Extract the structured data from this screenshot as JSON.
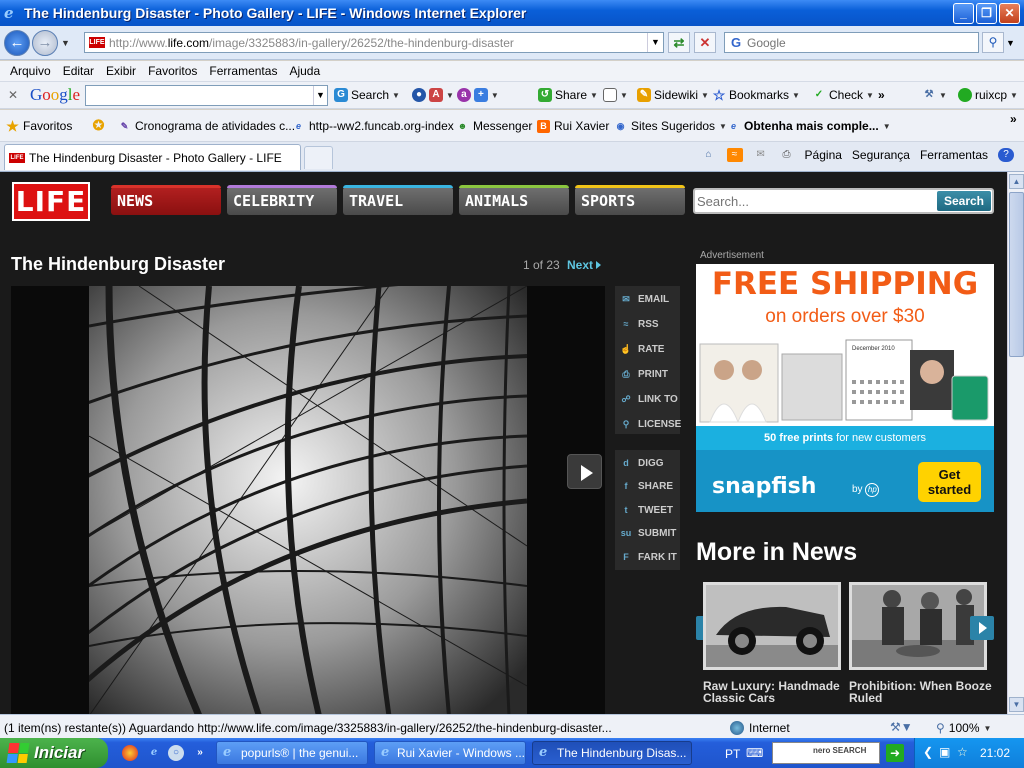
{
  "window": {
    "title": "The Hindenburg Disaster - Photo Gallery - LIFE - Windows Internet Explorer",
    "minimize": "_",
    "maximize": "❐",
    "close": "✕"
  },
  "address_bar": {
    "url_prefix": "http://www.",
    "url_domain": "life.com",
    "url_path": "/image/3325883/in-gallery/26252/the-hindenburg-disaster",
    "favicon": "LIFE",
    "search_placeholder": "Google"
  },
  "menu": [
    "Arquivo",
    "Editar",
    "Exibir",
    "Favoritos",
    "Ferramentas",
    "Ajuda"
  ],
  "google_toolbar": {
    "logo": [
      "G",
      "o",
      "o",
      "g",
      "l",
      "e"
    ],
    "search_label": "Search",
    "share_label": "Share",
    "sidewiki_label": "Sidewiki",
    "bookmarks_label": "Bookmarks",
    "check_label": "Check",
    "more": "»",
    "user": "ruixcp"
  },
  "favorites_bar": {
    "favorites_label": "Favoritos",
    "items": [
      "Cronograma de atividades c...",
      "http--ww2.funcab.org-index",
      "Messenger",
      "Rui Xavier",
      "Sites Sugeridos",
      "Obtenha mais comple..."
    ]
  },
  "tabs": {
    "active_tab": "The Hindenburg Disaster - Photo Gallery - LIFE"
  },
  "command_bar": {
    "pagina": "Página",
    "seguranca": "Segurança",
    "ferramentas": "Ferramentas"
  },
  "site": {
    "logo": "LIFE",
    "nav": [
      {
        "label": "NEWS",
        "color": "#d9322a"
      },
      {
        "label": "CELEBRITY",
        "color": "#b27ad8"
      },
      {
        "label": "TRAVEL",
        "color": "#3ab4e0"
      },
      {
        "label": "ANIMALS",
        "color": "#8cc63f"
      },
      {
        "label": "SPORTS",
        "color": "#f2c418"
      }
    ],
    "search_placeholder": "Search...",
    "search_button": "Search"
  },
  "gallery": {
    "title": "The Hindenburg Disaster",
    "pager": "1 of 23",
    "next": "Next"
  },
  "share_tools": {
    "primary": [
      "EMAIL",
      "RSS",
      "RATE",
      "PRINT",
      "LINK TO",
      "LICENSE"
    ],
    "social": [
      "DIGG",
      "SHARE",
      "TWEET",
      "SUBMIT",
      "FARK IT"
    ]
  },
  "advertisement": {
    "label": "Advertisement",
    "headline": "FREE SHIPPING",
    "subhead": "on orders over $30",
    "calendar_label": "December 2010",
    "prints_bold": "50 free prints",
    "prints_rest": " for new customers",
    "brand": "snapfish",
    "by": "by",
    "hp": "hp",
    "cta": "Get started"
  },
  "more_in_news": {
    "title": "More in News",
    "items": [
      "Raw Luxury: Handmade Classic Cars",
      "Prohibition: When Booze Ruled"
    ]
  },
  "status_bar": {
    "message": "(1 item(ns) restante(s)) Aguardando http://www.life.com/image/3325883/in-gallery/26252/the-hindenburg-disaster...",
    "zone": "Internet",
    "zoom": "100%"
  },
  "taskbar": {
    "start": "Iniciar",
    "items": [
      "popurls® | the genui...",
      "Rui Xavier - Windows ...",
      "The Hindenburg Disas..."
    ],
    "language": "PT",
    "nero": "nero SEARCH",
    "clock": "21:02"
  }
}
